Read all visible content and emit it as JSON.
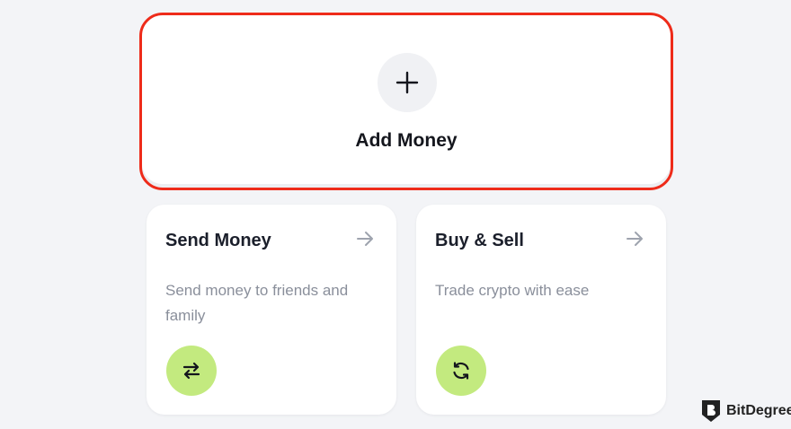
{
  "add_money": {
    "label": "Add Money",
    "icon": "plus-icon",
    "highlight_color": "#ee2b1a"
  },
  "cards": [
    {
      "title": "Send Money",
      "description": "Send money to friends and family",
      "arrow_icon": "arrow-right-icon",
      "action_icon": "swap-arrows-icon",
      "icon_color": "#c3ea7f"
    },
    {
      "title": "Buy & Sell",
      "description": "Trade crypto with ease",
      "arrow_icon": "arrow-right-icon",
      "action_icon": "refresh-icon",
      "icon_color": "#c3ea7f"
    }
  ],
  "watermark": {
    "text": "BitDegree",
    "icon": "bitdegree-shield-icon"
  }
}
